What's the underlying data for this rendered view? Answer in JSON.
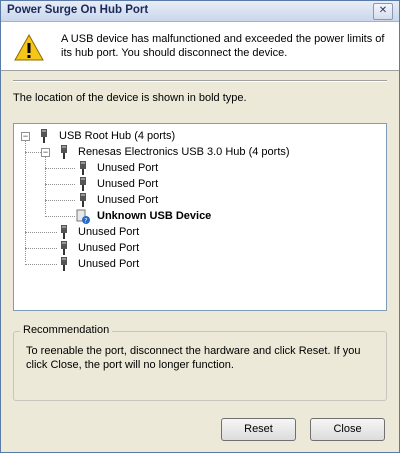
{
  "window": {
    "title": "Power Surge On Hub Port",
    "close_glyph": "✕"
  },
  "header": {
    "icon": "warning-triangle-icon",
    "message": "A USB device has malfunctioned and exceeded the power limits of its hub port. You should disconnect the device."
  },
  "location_text": "The location of the device is shown in bold type.",
  "tree": {
    "root": {
      "label": "USB Root Hub (4 ports)",
      "expander": "−"
    },
    "hub": {
      "label": "Renesas Electronics USB 3.0 Hub (4 ports)",
      "expander": "−"
    },
    "hub_ports": [
      "Unused Port",
      "Unused Port",
      "Unused Port"
    ],
    "device": {
      "label": "Unknown USB Device",
      "icon": "unknown-device-icon",
      "bold": true
    },
    "root_ports": [
      "Unused Port",
      "Unused Port",
      "Unused Port"
    ]
  },
  "recommendation": {
    "title": "Recommendation",
    "text": "To reenable the port, disconnect the hardware and click Reset. If you click Close, the port will no longer function."
  },
  "buttons": {
    "reset": "Reset",
    "close": "Close"
  },
  "colors": {
    "title_text": "#1a2a5a",
    "tree_border": "#7f9db9",
    "warning": "#f5c518"
  }
}
